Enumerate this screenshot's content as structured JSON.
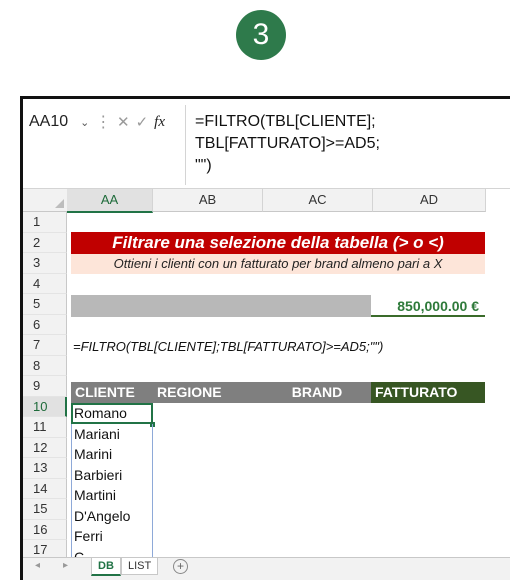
{
  "step": "3",
  "formula_bar": {
    "name_box": "AA10",
    "lines": [
      "=FILTRO(TBL[CLIENTE];",
      "TBL[FATTURATO]>=AD5;",
      "\"\")"
    ]
  },
  "columns": [
    "AA",
    "AB",
    "AC",
    "AD"
  ],
  "rows": [
    "1",
    "2",
    "3",
    "4",
    "5",
    "6",
    "7",
    "8",
    "9",
    "10",
    "11",
    "12",
    "13",
    "14",
    "15",
    "16",
    "17"
  ],
  "sheet": {
    "title": "Filtrare una selezione della tabella (> o <)",
    "subtitle": "Ottieni i clienti con un fatturato per brand almeno pari a X",
    "amount": "850,000.00  €",
    "formula_display": "=FILTRO(TBL[CLIENTE];TBL[FATTURATO]>=AD5;\"\")",
    "headers": [
      "CLIENTE",
      "REGIONE",
      "BRAND",
      "FATTURATO"
    ],
    "clients": [
      "Romano",
      "Mariani",
      "Marini",
      "Barbieri",
      "Martini",
      "D'Angelo",
      "Ferri",
      "C..."
    ]
  },
  "tabs": [
    "DB",
    "LIST"
  ],
  "colors": {
    "title_red": "#c00000",
    "subtitle_peach": "#fde5d9",
    "excel_green": "#217346",
    "header_grey": "#7f7f7f",
    "fatturato_green": "#375623"
  }
}
